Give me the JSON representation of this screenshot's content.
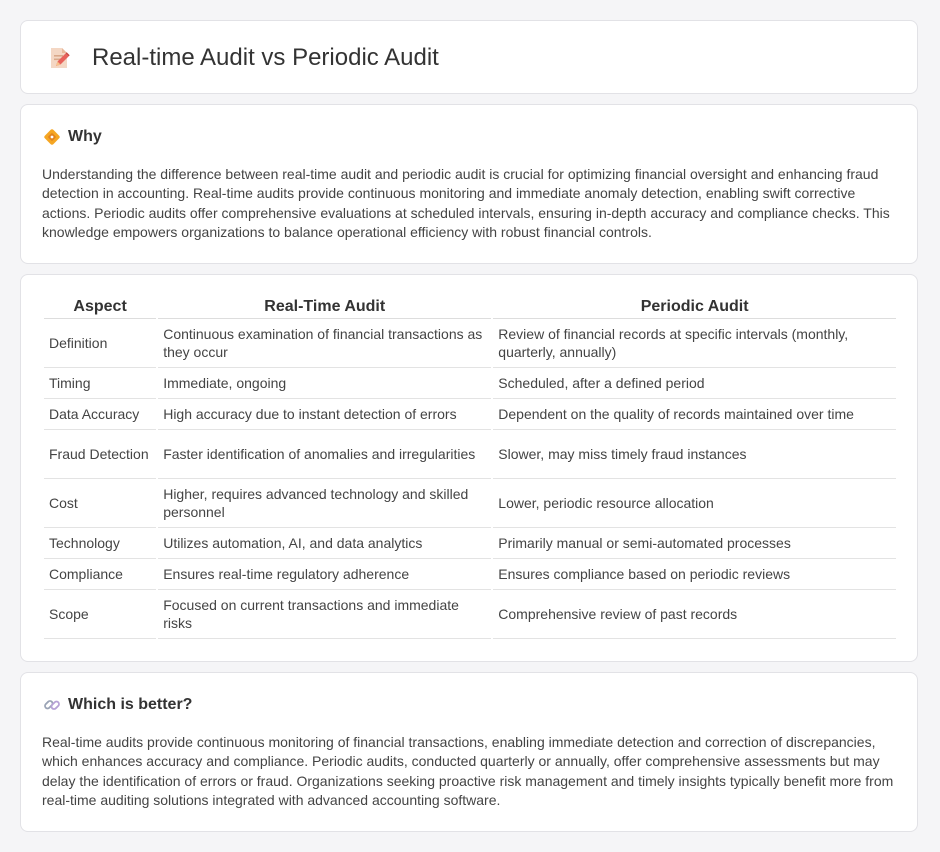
{
  "header": {
    "title": "Real-time Audit vs Periodic Audit",
    "icon": "document-pencil-icon"
  },
  "why": {
    "title": "Why",
    "icon": "diamond-icon",
    "text": "Understanding the difference between real-time audit and periodic audit is crucial for optimizing financial oversight and enhancing fraud detection in accounting. Real-time audits provide continuous monitoring and immediate anomaly detection, enabling swift corrective actions. Periodic audits offer comprehensive evaluations at scheduled intervals, ensuring in-depth accuracy and compliance checks. This knowledge empowers organizations to balance operational efficiency with robust financial controls."
  },
  "table": {
    "headers": [
      "Aspect",
      "Real-Time Audit",
      "Periodic Audit"
    ],
    "rows": [
      {
        "aspect": "Definition",
        "realtime": "Continuous examination of financial transactions as they occur",
        "periodic": "Review of financial records at specific intervals (monthly, quarterly, annually)"
      },
      {
        "aspect": "Timing",
        "realtime": "Immediate, ongoing",
        "periodic": "Scheduled, after a defined period"
      },
      {
        "aspect": "Data Accuracy",
        "realtime": "High accuracy due to instant detection of errors",
        "periodic": "Dependent on the quality of records maintained over time"
      },
      {
        "aspect": "Fraud Detection",
        "realtime": "Faster identification of anomalies and irregularities",
        "periodic": "Slower, may miss timely fraud instances"
      },
      {
        "aspect": "Cost",
        "realtime": "Higher, requires advanced technology and skilled personnel",
        "periodic": "Lower, periodic resource allocation"
      },
      {
        "aspect": "Technology",
        "realtime": "Utilizes automation, AI, and data analytics",
        "periodic": "Primarily manual or semi-automated processes"
      },
      {
        "aspect": "Compliance",
        "realtime": "Ensures real-time regulatory adherence",
        "periodic": "Ensures compliance based on periodic reviews"
      },
      {
        "aspect": "Scope",
        "realtime": "Focused on current transactions and immediate risks",
        "periodic": "Comprehensive review of past records"
      }
    ]
  },
  "better": {
    "title": "Which is better?",
    "icon": "link-icon",
    "text": "Real-time audits provide continuous monitoring of financial transactions, enabling immediate detection and correction of discrepancies, which enhances accuracy and compliance. Periodic audits, conducted quarterly or annually, offer comprehensive assessments but may delay the identification of errors or fraud. Organizations seeking proactive risk management and timely insights typically benefit more from real-time auditing solutions integrated with advanced accounting software."
  }
}
